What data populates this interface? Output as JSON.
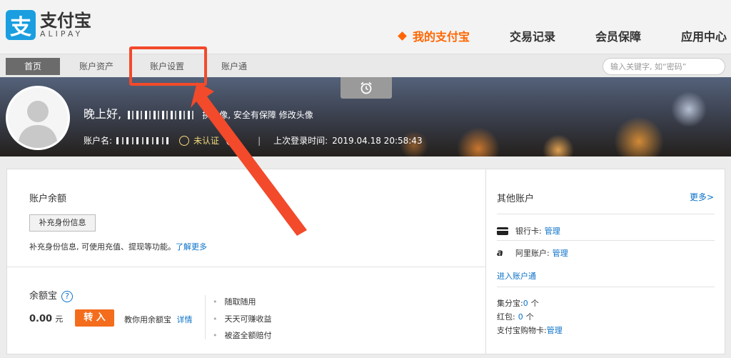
{
  "logo": {
    "cn": "支付宝",
    "en": "ALIPAY",
    "glyph": "支"
  },
  "mainnav": [
    {
      "label": "我的支付宝",
      "active": true
    },
    {
      "label": "交易记录"
    },
    {
      "label": "会员保障"
    },
    {
      "label": "应用中心"
    }
  ],
  "subnav": {
    "tabs": [
      "首页",
      "账户资产",
      "账户设置",
      "账户通"
    ],
    "search_placeholder": "输入关键字, 如“密码”"
  },
  "banner": {
    "greeting": "晚上好,",
    "profile_text": "换头像, 安全有保障 修改头像",
    "account_label": "账户名:",
    "status": "未认证",
    "separator": "|",
    "last_login_label": "上次登录时间:",
    "last_login_time": "2019.04.18 20:58:43"
  },
  "balance": {
    "title": "账户余额",
    "btn_info": "补充身份信息",
    "note": "补充身份信息, 可使用充值、提现等功能。",
    "learn_more": "了解更多"
  },
  "yuebao": {
    "title": "余额宝",
    "help": "?",
    "amount": "0.00",
    "unit": "元",
    "btn_in": "转 入",
    "teach": "教你用余额宝",
    "details": "详情",
    "features": [
      "随取随用",
      "天天可赚收益",
      "被盗全额赔付"
    ]
  },
  "other_accounts": {
    "title": "其他账户",
    "more": "更多>",
    "bank_label": "银行卡:",
    "bank_manage": "管理",
    "ali_label": "阿里账户:",
    "ali_manage": "管理",
    "enter": "进入账户通",
    "points_label": "集分宝:",
    "points_value": "0",
    "points_unit": "个",
    "redpack_label": "红包:",
    "redpack_value": "0",
    "redpack_unit": "个",
    "card_label": "支付宝购物卡:",
    "card_manage": "管理"
  },
  "colors": {
    "accent": "#ff6600",
    "brand": "#1a9ee0",
    "link": "#0b72c9",
    "annotation": "#f24a2b"
  }
}
